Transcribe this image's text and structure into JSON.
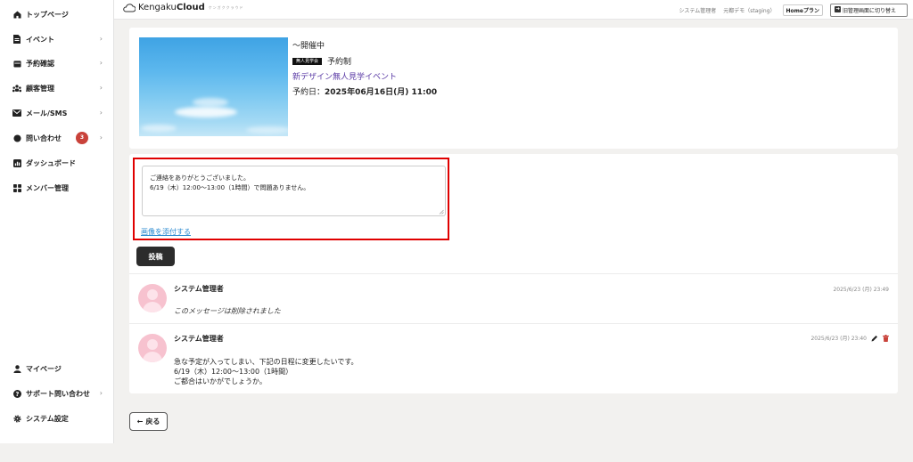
{
  "sidebar": {
    "items": [
      {
        "label": "トップページ",
        "icon": "home-icon",
        "chevron": false
      },
      {
        "label": "イベント",
        "icon": "document-icon",
        "chevron": true
      },
      {
        "label": "予約確認",
        "icon": "calendar-icon",
        "chevron": true
      },
      {
        "label": "顧客管理",
        "icon": "users-icon",
        "chevron": true
      },
      {
        "label": "メール/SMS",
        "icon": "mail-icon",
        "chevron": true
      },
      {
        "label": "問い合わせ",
        "icon": "chat-icon",
        "chevron": true,
        "badge": "3"
      },
      {
        "label": "ダッシュボード",
        "icon": "chart-icon",
        "chevron": false
      },
      {
        "label": "メンバー管理",
        "icon": "grid-icon",
        "chevron": false
      }
    ],
    "bottom_items": [
      {
        "label": "マイページ",
        "icon": "user-icon",
        "chevron": false
      },
      {
        "label": "サポート問い合わせ",
        "icon": "help-icon",
        "chevron": true
      },
      {
        "label": "システム設定",
        "icon": "gear-icon",
        "chevron": false
      }
    ]
  },
  "topbar": {
    "logo_text": "Kengaku",
    "logo_bold": "Cloud",
    "logo_sub": "ケンガククラウド",
    "user": "システム管理者",
    "company": "元都デモ（staging）",
    "plan": "Homeプラン",
    "switch_label": "旧管理画面に切り替え"
  },
  "event": {
    "status": "〜開催中",
    "tag": "無人見学会",
    "reservation_type": "予約制",
    "title": "新デザイン無人見学イベント",
    "date_label": "予約日：",
    "date_value": "2025年06月16日(月) 11:00"
  },
  "post_form": {
    "message": "ご連絡をありがとうございました。\n6/19（木）12:00〜13:00（1時間）で問題ありません。",
    "attach_label": "画像を添付する",
    "submit_label": "投稿"
  },
  "messages": [
    {
      "author": "システム管理者",
      "time": "2025/6/23 (月) 23:49",
      "text": "このメッセージは削除されました",
      "deleted": true
    },
    {
      "author": "システム管理者",
      "time": "2025/6/23 (月) 23:40",
      "text": "急な予定が入ってしまい、下記の日程に変更したいです。\n6/19（木）12:00〜13:00（1時間）\nご都合はいかがでしょうか。",
      "deleted": false
    }
  ],
  "back_label": "戻る",
  "colors": {
    "badge": "#c9423a",
    "link": "#5a3aa5",
    "attach_link": "#2a8ad0",
    "highlight": "#e00000",
    "avatar": "#f7c2cf"
  }
}
